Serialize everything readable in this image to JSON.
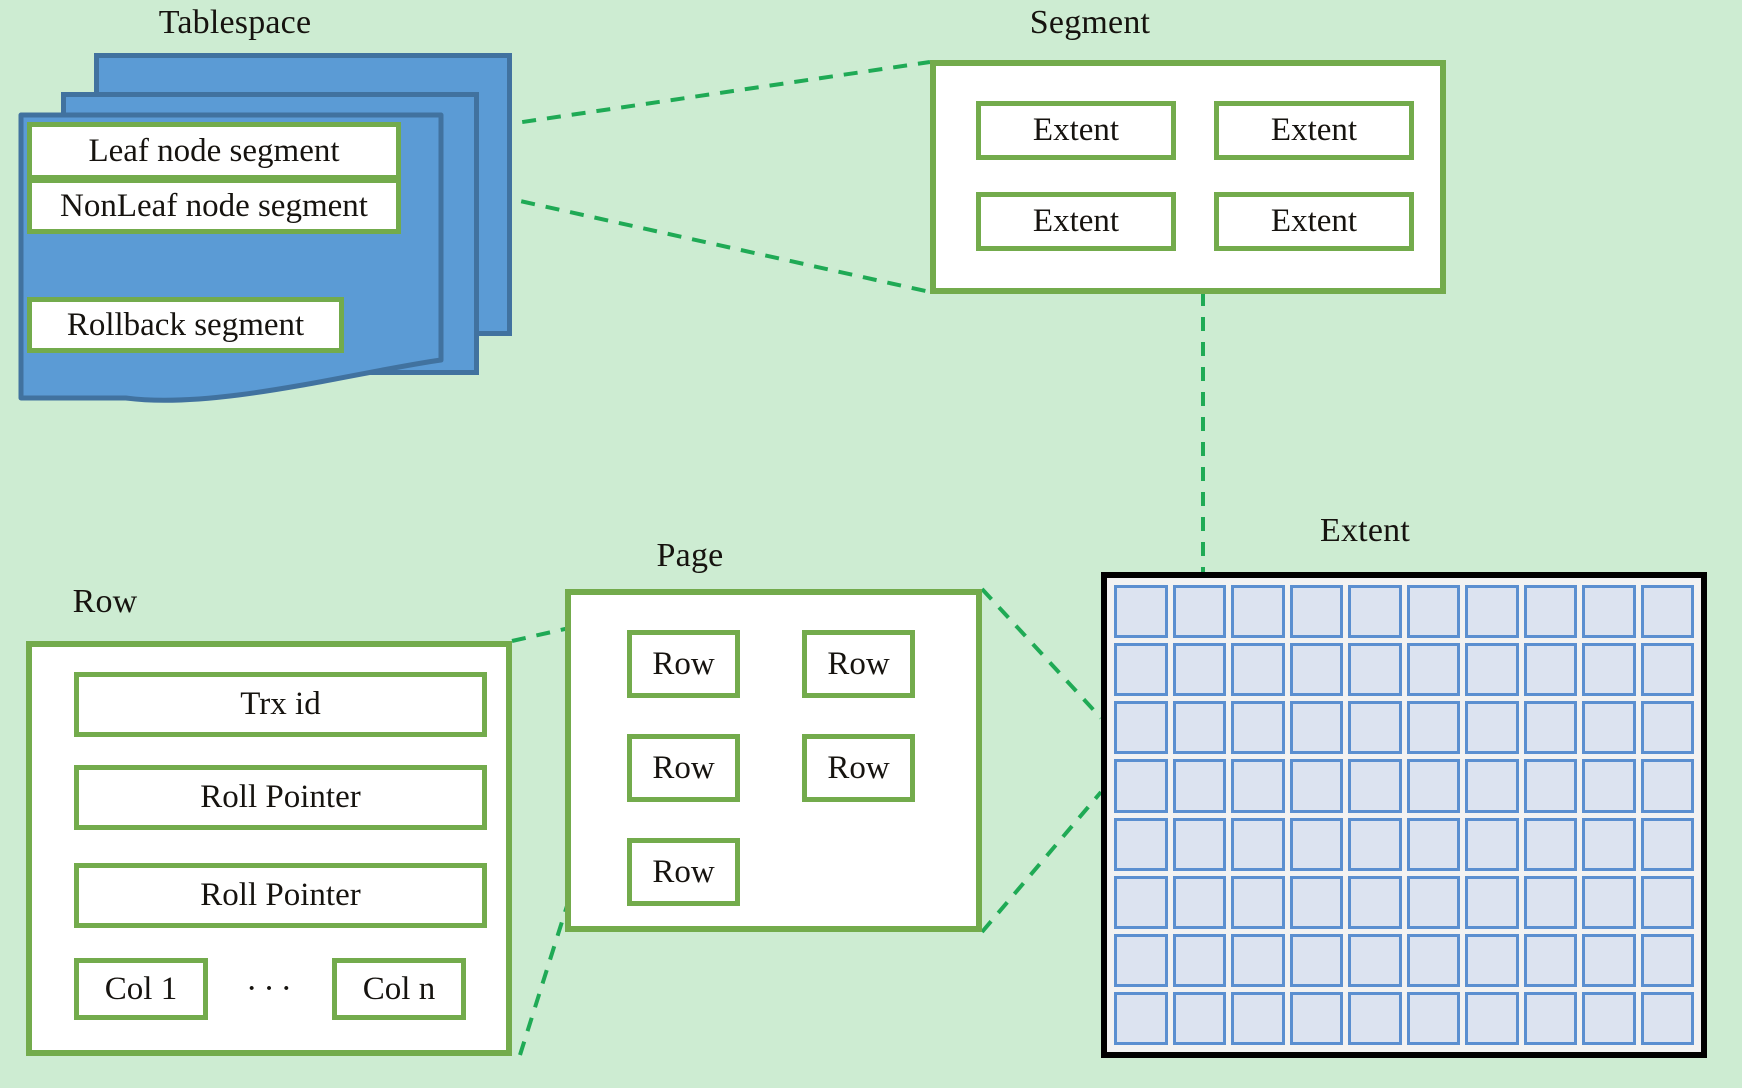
{
  "page": {
    "background_color": "#cdecd2",
    "accent_green": "#73ab4c",
    "dash_green": "#1faa55",
    "tablespace_blue": "#5b9bd5",
    "tablespace_border": "#41729f",
    "extent_cell_fill": "#dce3f0",
    "extent_cell_border": "#5b8fd0",
    "extent_border": "#000000"
  },
  "tablespace": {
    "caption": "Tablespace",
    "segments": [
      {
        "label": "Leaf node segment"
      },
      {
        "label": "NonLeaf node segment"
      },
      {
        "label": "Rollback segment"
      }
    ],
    "card_count": 3
  },
  "segment": {
    "caption": "Segment",
    "extents": [
      {
        "label": "Extent"
      },
      {
        "label": "Extent"
      },
      {
        "label": "Extent"
      },
      {
        "label": "Extent"
      }
    ]
  },
  "extent": {
    "caption": "Extent",
    "grid_columns": 10,
    "grid_rows": 8,
    "cell_count": 80
  },
  "page_box": {
    "caption": "Page",
    "rows": [
      {
        "label": "Row"
      },
      {
        "label": "Row"
      },
      {
        "label": "Row"
      },
      {
        "label": "Row"
      },
      {
        "label": "Row"
      }
    ]
  },
  "row": {
    "caption": "Row",
    "fields": [
      {
        "label": "Trx id"
      },
      {
        "label": "Roll Pointer"
      },
      {
        "label": "Roll Pointer"
      }
    ],
    "columns": {
      "first": "Col 1",
      "ellipsis": "···",
      "last": "Col n"
    }
  }
}
